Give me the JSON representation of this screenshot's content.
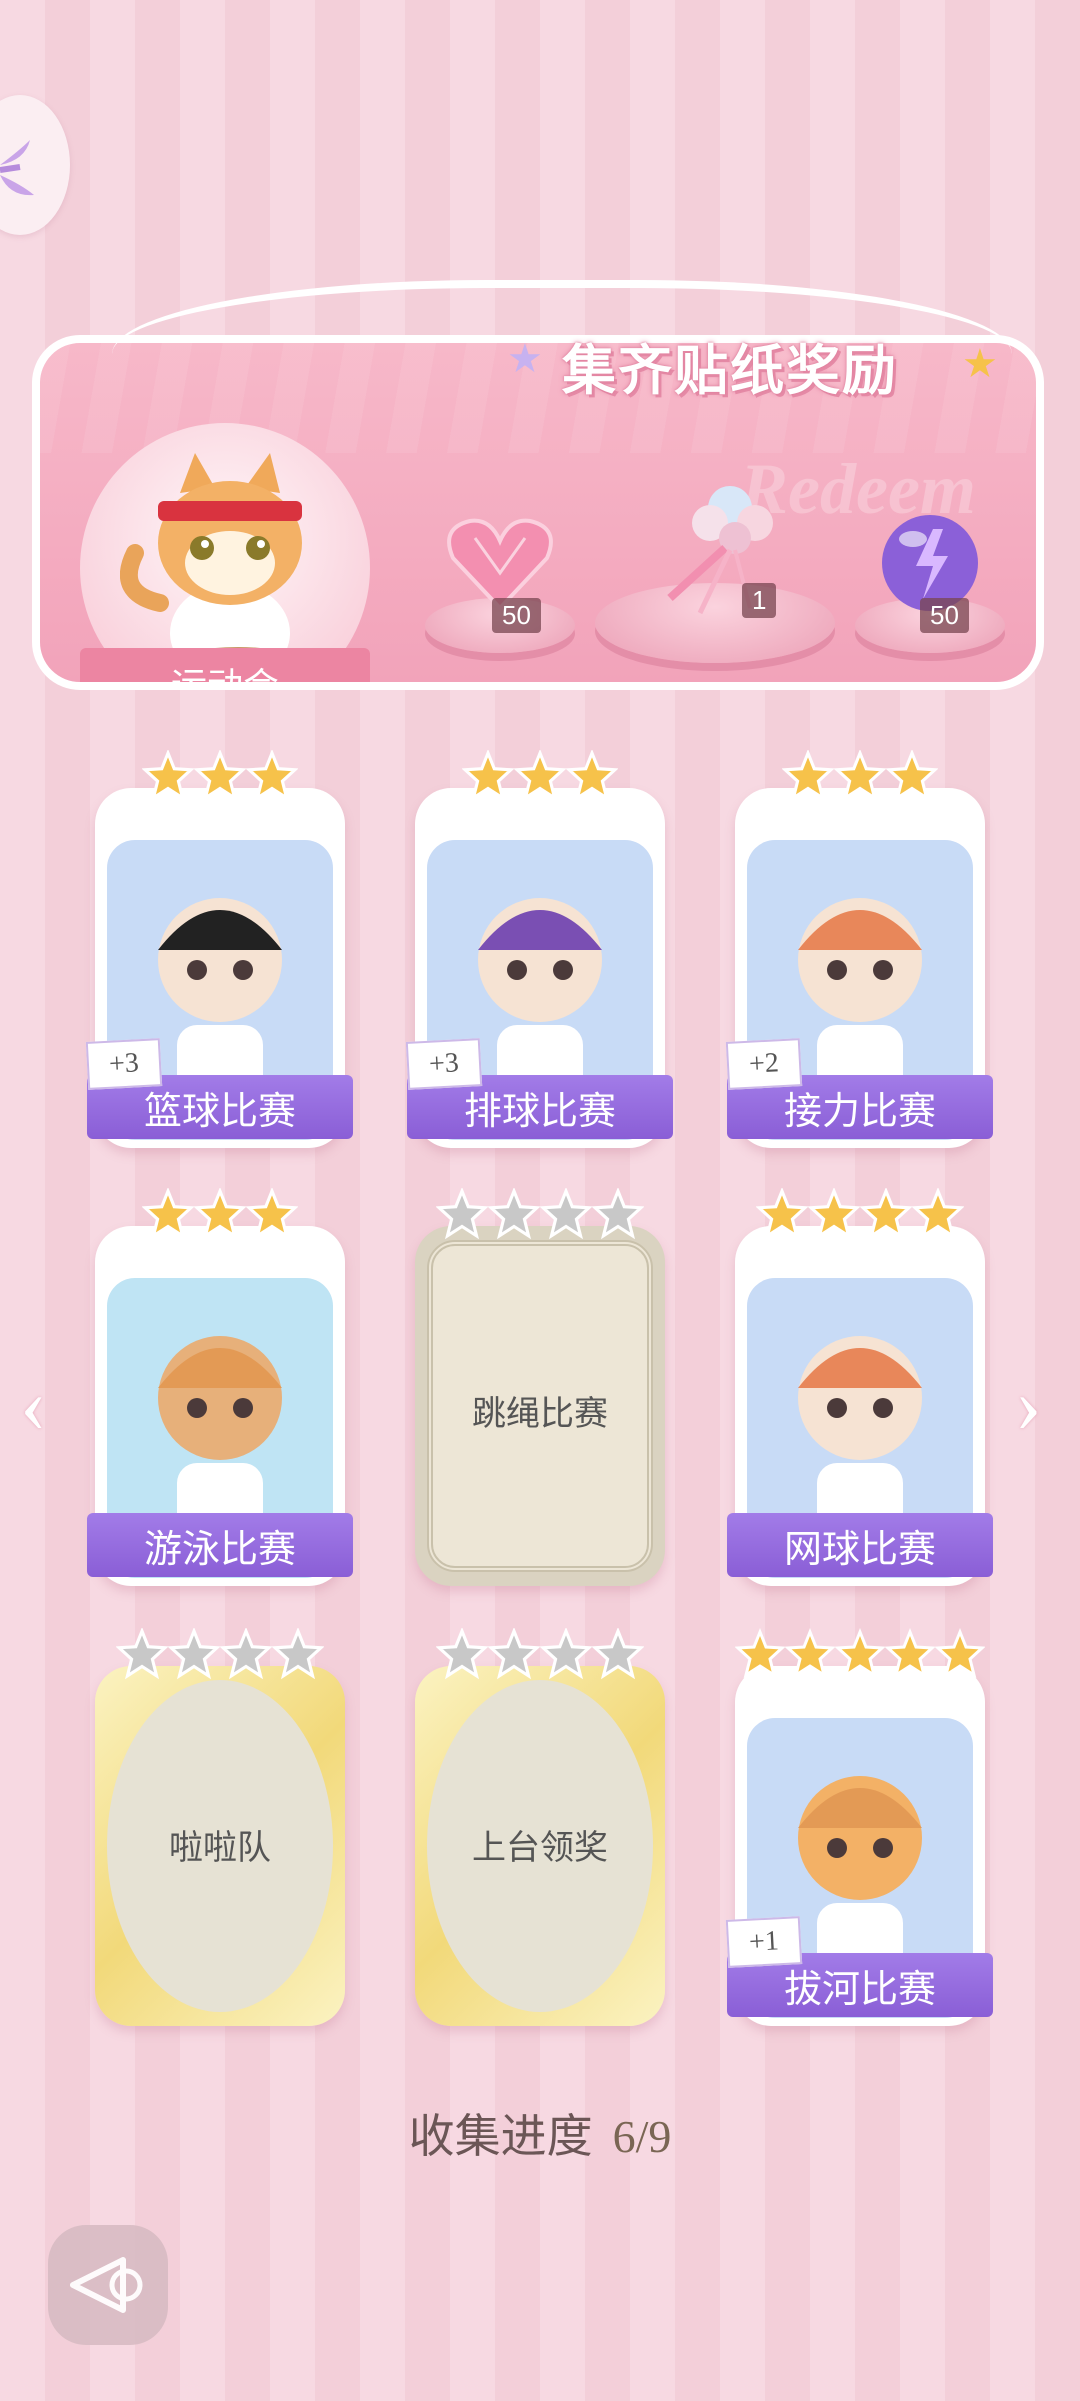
{
  "reward_panel": {
    "title": "集齐贴纸奖励",
    "watermark": "Redeem",
    "event_name": "运动会",
    "rewards": [
      {
        "item": "pink-heart-gem",
        "count": "50"
      },
      {
        "item": "bouquet",
        "count": "1"
      },
      {
        "item": "purple-energy-orb",
        "count": "50"
      }
    ]
  },
  "cards": [
    {
      "name": "篮球比赛",
      "stars": 3,
      "max_stars": 3,
      "bonus": "+3",
      "collected": true
    },
    {
      "name": "排球比赛",
      "stars": 3,
      "max_stars": 3,
      "bonus": "+3",
      "collected": true
    },
    {
      "name": "接力比赛",
      "stars": 3,
      "max_stars": 3,
      "bonus": "+2",
      "collected": true
    },
    {
      "name": "游泳比赛",
      "stars": 3,
      "max_stars": 3,
      "bonus": "",
      "collected": true
    },
    {
      "name": "跳绳比赛",
      "stars": 0,
      "max_stars": 4,
      "bonus": "",
      "collected": false
    },
    {
      "name": "网球比赛",
      "stars": 4,
      "max_stars": 4,
      "bonus": "",
      "collected": true
    },
    {
      "name": "啦啦队",
      "stars": 0,
      "max_stars": 4,
      "bonus": "",
      "collected": false
    },
    {
      "name": "上台领奖",
      "stars": 0,
      "max_stars": 4,
      "bonus": "",
      "collected": false
    },
    {
      "name": "拔河比赛",
      "stars": 5,
      "max_stars": 5,
      "bonus": "+1",
      "collected": true
    }
  ],
  "progress": {
    "label": "收集进度",
    "value": "6/9"
  },
  "colors": {
    "accent_purple": "#8a5ed6",
    "star_gold": "#f6c24a",
    "star_gray": "#c8c8c8",
    "panel_pink": "#f2a3ba"
  }
}
